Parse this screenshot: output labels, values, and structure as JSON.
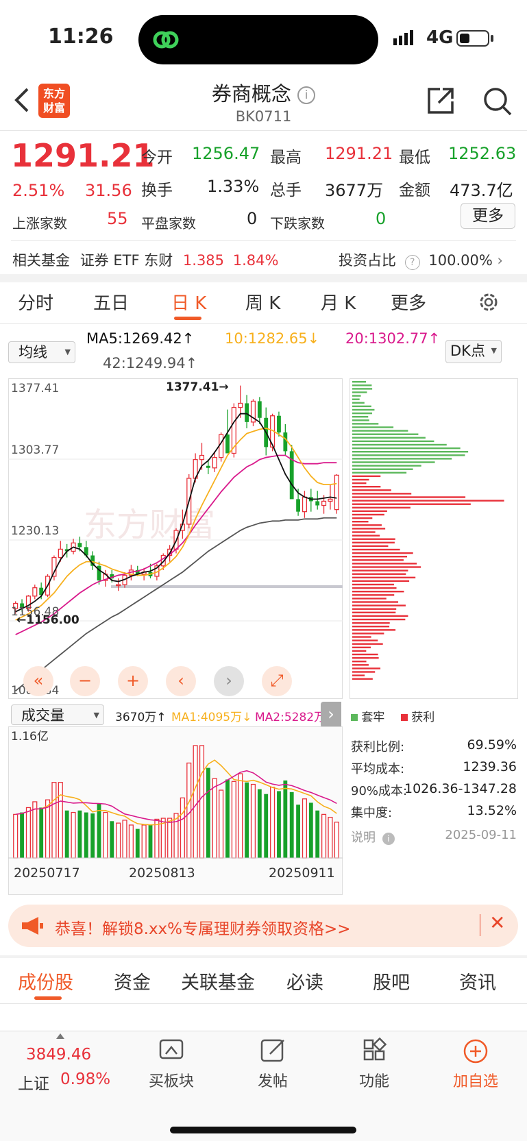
{
  "status_bar": {
    "time": "11:26",
    "network": "4G"
  },
  "header": {
    "title": "券商概念",
    "code": "BK0711",
    "logo_text": "东方财富"
  },
  "quote": {
    "price": "1291.21",
    "change_pct": "2.51%",
    "change": "31.56",
    "open_label": "今开",
    "open": "1256.47",
    "high_label": "最高",
    "high": "1291.21",
    "low_label": "最低",
    "low": "1252.63",
    "turnover_label": "换手",
    "turnover": "1.33%",
    "volume_label": "总手",
    "volume": "3677万",
    "amount_label": "金额",
    "amount": "473.7亿",
    "up_label": "上涨家数",
    "up": "55",
    "flat_label": "平盘家数",
    "flat": "0",
    "down_label": "下跌家数",
    "down": "0",
    "more": "更多"
  },
  "fund": {
    "label": "相关基金",
    "name": "证券 ETF 东财",
    "price": "1.385",
    "pct": "1.84%",
    "ratio_label": "投资占比",
    "ratio": "100.00%"
  },
  "period_tabs": [
    "分时",
    "五日",
    "日 K",
    "周 K",
    "月 K",
    "更多"
  ],
  "active_tab": "日 K",
  "ma_bar": {
    "dropdown": "均线",
    "ma5": "MA5:1269.42↑",
    "ma10": "10:1282.65↓",
    "ma20": "20:1302.77↑",
    "ma42": "42:1249.94↑",
    "dk": "DK点"
  },
  "kline": {
    "y_labels": [
      "1377.41",
      "1303.77",
      "1230.13",
      "1156.48",
      "1082.84"
    ],
    "high_marker": "1377.41→",
    "low_marker": "←1156.00",
    "watermark": "东方财富"
  },
  "volume_bar": {
    "dropdown": "成交量",
    "vol": "3670万↑",
    "ma1": "MA1:4095万↓",
    "ma2": "MA2:5282万",
    "ymax": "1.16亿",
    "dates": [
      "20250717",
      "20250813",
      "20250911"
    ]
  },
  "chip": {
    "legend_trapped": "套牢",
    "legend_profit": "获利",
    "rows": [
      {
        "label": "获利比例:",
        "value": "69.59%"
      },
      {
        "label": "平均成本:",
        "value": "1239.36"
      },
      {
        "label": "90%成本:",
        "value": "1026.36-1347.28"
      },
      {
        "label": "集中度:",
        "value": "13.52%"
      }
    ],
    "note_label": "说明",
    "date": "2025-09-11"
  },
  "banner": {
    "text": "恭喜！解锁8.xx%专属理财券领取资格>>"
  },
  "bottom_tabs": [
    "成份股",
    "资金",
    "关联基金",
    "必读",
    "股吧",
    "资讯"
  ],
  "bottom_bar": {
    "index_value": "3849.46",
    "index_name": "上证",
    "index_pct": "0.98%",
    "items": [
      "买板块",
      "发帖",
      "功能",
      "加自选"
    ]
  },
  "colors": {
    "up": "#e8313a",
    "down": "#17a12a",
    "accent": "#f05a28"
  },
  "chart_data": {
    "type": "candlestick",
    "candles": [
      [
        1163,
        1170,
        1158,
        1168
      ],
      [
        1168,
        1172,
        1160,
        1164
      ],
      [
        1163,
        1176,
        1160,
        1175
      ],
      [
        1175,
        1186,
        1172,
        1183
      ],
      [
        1183,
        1188,
        1172,
        1176
      ],
      [
        1176,
        1196,
        1174,
        1194
      ],
      [
        1194,
        1214,
        1190,
        1212
      ],
      [
        1212,
        1228,
        1208,
        1220
      ],
      [
        1220,
        1225,
        1212,
        1218
      ],
      [
        1218,
        1230,
        1215,
        1226
      ],
      [
        1226,
        1232,
        1218,
        1222
      ],
      [
        1222,
        1228,
        1212,
        1214
      ],
      [
        1214,
        1218,
        1200,
        1204
      ],
      [
        1204,
        1208,
        1186,
        1190
      ],
      [
        1190,
        1200,
        1184,
        1196
      ],
      [
        1196,
        1200,
        1188,
        1192
      ],
      [
        1185,
        1192,
        1180,
        1186
      ],
      [
        1186,
        1198,
        1183,
        1195
      ],
      [
        1195,
        1205,
        1190,
        1200
      ],
      [
        1200,
        1204,
        1194,
        1196
      ],
      [
        1196,
        1202,
        1190,
        1198
      ],
      [
        1198,
        1206,
        1192,
        1194
      ],
      [
        1194,
        1206,
        1190,
        1204
      ],
      [
        1204,
        1216,
        1200,
        1214
      ],
      [
        1214,
        1224,
        1208,
        1220
      ],
      [
        1220,
        1240,
        1216,
        1238
      ],
      [
        1238,
        1258,
        1230,
        1244
      ],
      [
        1244,
        1292,
        1240,
        1288
      ],
      [
        1288,
        1312,
        1284,
        1306
      ],
      [
        1306,
        1322,
        1296,
        1310
      ],
      [
        1300,
        1306,
        1292,
        1298
      ],
      [
        1298,
        1314,
        1294,
        1308
      ],
      [
        1308,
        1332,
        1304,
        1330
      ],
      [
        1330,
        1354,
        1322,
        1312
      ],
      [
        1312,
        1360,
        1308,
        1356
      ],
      [
        1356,
        1377,
        1346,
        1360
      ],
      [
        1360,
        1368,
        1336,
        1342
      ],
      [
        1342,
        1364,
        1338,
        1362
      ],
      [
        1362,
        1366,
        1340,
        1346
      ],
      [
        1346,
        1356,
        1310,
        1318
      ],
      [
        1318,
        1350,
        1314,
        1348
      ],
      [
        1348,
        1352,
        1328,
        1332
      ],
      [
        1332,
        1340,
        1310,
        1314
      ],
      [
        1314,
        1320,
        1276,
        1268
      ],
      [
        1268,
        1278,
        1252,
        1256
      ],
      [
        1256,
        1276,
        1250,
        1270
      ],
      [
        1270,
        1278,
        1256,
        1266
      ],
      [
        1266,
        1276,
        1258,
        1262
      ],
      [
        1262,
        1272,
        1254,
        1266
      ],
      [
        1266,
        1282,
        1258,
        1268
      ],
      [
        1258,
        1292,
        1254,
        1291
      ]
    ],
    "ma5": [
      1160,
      1163,
      1166,
      1170,
      1175,
      1185,
      1198,
      1210,
      1218,
      1222,
      1220,
      1214,
      1206,
      1200,
      1196,
      1190,
      1189,
      1191,
      1194,
      1196,
      1198,
      1199,
      1202,
      1208,
      1216,
      1228,
      1244,
      1266,
      1288,
      1300,
      1305,
      1313,
      1322,
      1332,
      1342,
      1350,
      1350,
      1346,
      1342,
      1332,
      1320,
      1306,
      1292,
      1282,
      1274,
      1270,
      1268,
      1268,
      1269,
      1270,
      1269
    ],
    "ma10": [
      1152,
      1155,
      1158,
      1162,
      1166,
      1172,
      1178,
      1186,
      1194,
      1200,
      1205,
      1208,
      1208,
      1206,
      1204,
      1201,
      1199,
      1197,
      1196,
      1195,
      1195,
      1196,
      1198,
      1202,
      1207,
      1213,
      1222,
      1234,
      1249,
      1262,
      1274,
      1286,
      1298,
      1310,
      1318,
      1325,
      1331,
      1333,
      1335,
      1336,
      1334,
      1330,
      1326,
      1318,
      1308,
      1298,
      1290,
      1284,
      1282,
      1282,
      1283
    ],
    "ma20": [
      1138,
      1141,
      1144,
      1147,
      1150,
      1154,
      1158,
      1163,
      1168,
      1173,
      1178,
      1182,
      1186,
      1189,
      1191,
      1193,
      1195,
      1196,
      1198,
      1199,
      1201,
      1204,
      1207,
      1211,
      1215,
      1220,
      1226,
      1234,
      1243,
      1251,
      1259,
      1267,
      1275,
      1282,
      1289,
      1294,
      1299,
      1302,
      1306,
      1308,
      1309,
      1310,
      1310,
      1306,
      1303,
      1302,
      1302,
      1302,
      1303,
      1303,
      1303
    ],
    "ma42": [
      1084,
      1089,
      1094,
      1099,
      1104,
      1109,
      1114,
      1119,
      1124,
      1129,
      1134,
      1139,
      1143,
      1147,
      1151,
      1155,
      1158,
      1162,
      1166,
      1170,
      1174,
      1178,
      1182,
      1186,
      1190,
      1194,
      1198,
      1203,
      1208,
      1213,
      1218,
      1222,
      1226,
      1230,
      1234,
      1238,
      1241,
      1243,
      1245,
      1246,
      1247,
      1247,
      1248,
      1248,
      1248,
      1249,
      1249,
      1249,
      1250,
      1250,
      1250
    ],
    "volume": [
      0.45,
      0.47,
      0.52,
      0.58,
      0.52,
      0.6,
      0.78,
      0.78,
      0.49,
      0.47,
      0.49,
      0.47,
      0.46,
      0.56,
      0.47,
      0.38,
      0.36,
      0.39,
      0.34,
      0.3,
      0.34,
      0.34,
      0.4,
      0.41,
      0.41,
      0.46,
      0.62,
      0.98,
      1.16,
      1.16,
      0.93,
      0.82,
      0.7,
      0.81,
      0.79,
      0.87,
      0.78,
      0.76,
      0.71,
      0.66,
      0.73,
      0.69,
      0.8,
      0.68,
      0.55,
      0.61,
      0.57,
      0.49,
      0.45,
      0.42,
      0.37
    ],
    "ylim": [
      1082.84,
      1377.41
    ],
    "vol_ylim": [
      0,
      1.16
    ]
  }
}
